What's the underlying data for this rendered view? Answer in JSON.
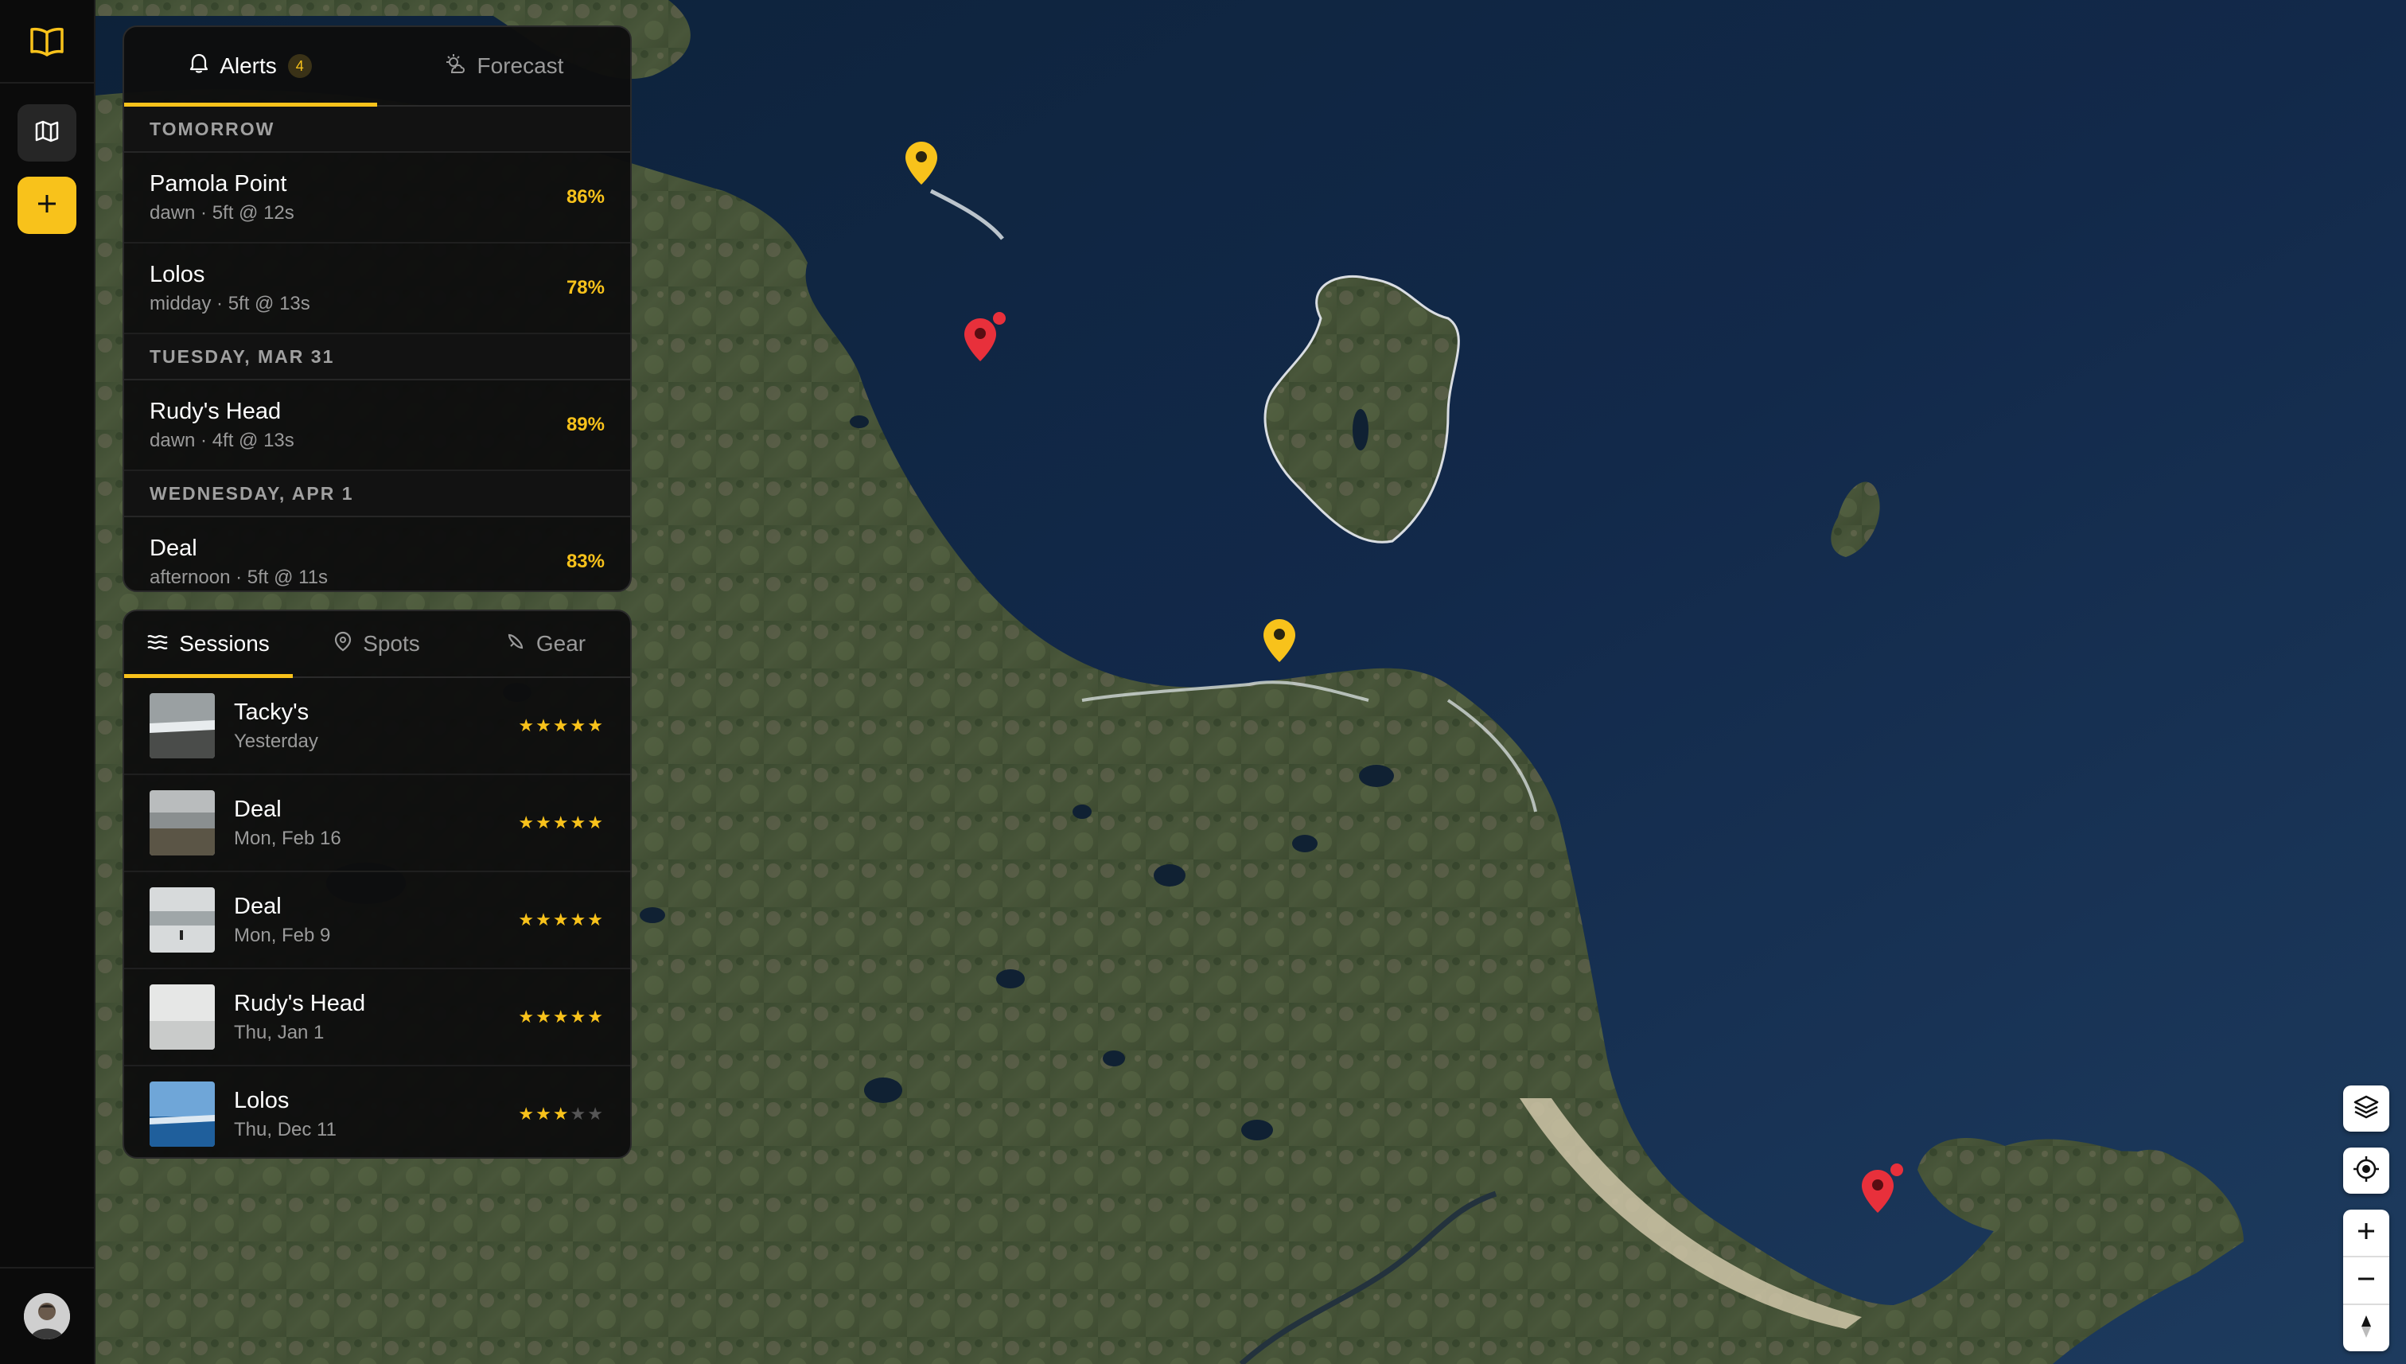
{
  "colors": {
    "accent": "#f8c21b",
    "alert_pin": "#e8303b",
    "panel_bg": "#0e0e0e",
    "rail_bg": "#0b0b0b"
  },
  "rail": {
    "logo_icon": "book-icon",
    "map_icon": "map-icon",
    "add_icon": "plus-icon",
    "avatar": "user-avatar"
  },
  "alerts_panel": {
    "tabs": [
      {
        "label": "Alerts",
        "badge": "4",
        "icon": "bell-icon",
        "active": true
      },
      {
        "label": "Forecast",
        "icon": "sun-cloud-icon",
        "active": false
      }
    ],
    "groups": [
      {
        "heading": "TOMORROW",
        "items": [
          {
            "title": "Pamola Point",
            "sub": "dawn · 5ft @ 12s",
            "pct": "86%"
          },
          {
            "title": "Lolos",
            "sub": "midday · 5ft @ 13s",
            "pct": "78%"
          }
        ]
      },
      {
        "heading": "TUESDAY, MAR 31",
        "items": [
          {
            "title": "Rudy's Head",
            "sub": "dawn · 4ft @ 13s",
            "pct": "89%"
          }
        ]
      },
      {
        "heading": "WEDNESDAY, APR 1",
        "items": [
          {
            "title": "Deal",
            "sub": "afternoon · 5ft @ 11s",
            "pct": "83%"
          }
        ]
      }
    ]
  },
  "sessions_panel": {
    "tabs": [
      {
        "label": "Sessions",
        "icon": "waves-icon",
        "active": true
      },
      {
        "label": "Spots",
        "icon": "pin-icon",
        "active": false
      },
      {
        "label": "Gear",
        "icon": "surfboard-icon",
        "active": false
      }
    ],
    "items": [
      {
        "title": "Tacky's",
        "date": "Yesterday",
        "rating": 5
      },
      {
        "title": "Deal",
        "date": "Mon, Feb 16",
        "rating": 5
      },
      {
        "title": "Deal",
        "date": "Mon, Feb 9",
        "rating": 5
      },
      {
        "title": "Rudy's Head",
        "date": "Thu, Jan 1",
        "rating": 5
      },
      {
        "title": "Lolos",
        "date": "Thu, Dec 11",
        "rating": 3
      }
    ]
  },
  "map_controls": {
    "layers": "layers-icon",
    "locate": "locate-icon",
    "zoom_in": "plus-icon",
    "zoom_out": "minus-icon",
    "compass": "compass-icon"
  }
}
